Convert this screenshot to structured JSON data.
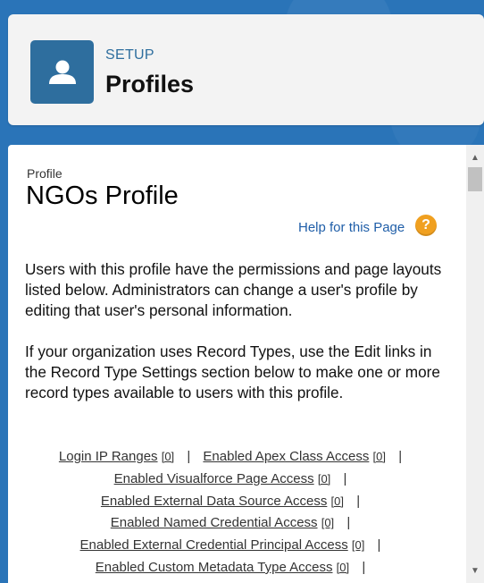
{
  "header": {
    "breadcrumb": "SETUP",
    "title": "Profiles",
    "icon": "user-icon"
  },
  "profile": {
    "label": "Profile",
    "name": "NGOs Profile"
  },
  "help": {
    "link": "Help for this Page",
    "icon": "help-icon"
  },
  "description": {
    "para1": "Users with this profile have the permissions and page layouts listed below. Administrators can change a user's profile by editing that user's personal information.",
    "para2": "If your organization uses Record Types, use the Edit links in the Record Type Settings section below to make one or more record types available to users with this profile."
  },
  "related_links": [
    {
      "label": "Login IP Ranges",
      "count": "[0]"
    },
    {
      "label": "Enabled Apex Class Access",
      "count": "[0]"
    },
    {
      "label": "Enabled Visualforce Page Access",
      "count": "[0]"
    },
    {
      "label": "Enabled External Data Source Access",
      "count": "[0]"
    },
    {
      "label": "Enabled Named Credential Access",
      "count": "[0]"
    },
    {
      "label": "Enabled External Credential Principal Access",
      "count": "[0]"
    },
    {
      "label": "Enabled Custom Metadata Type Access",
      "count": "[0]"
    }
  ],
  "colors": {
    "background": "#2a74b8",
    "icon_tile": "#2e6e9e",
    "link": "#1f5ea8",
    "help_badge": "#f0a020"
  }
}
